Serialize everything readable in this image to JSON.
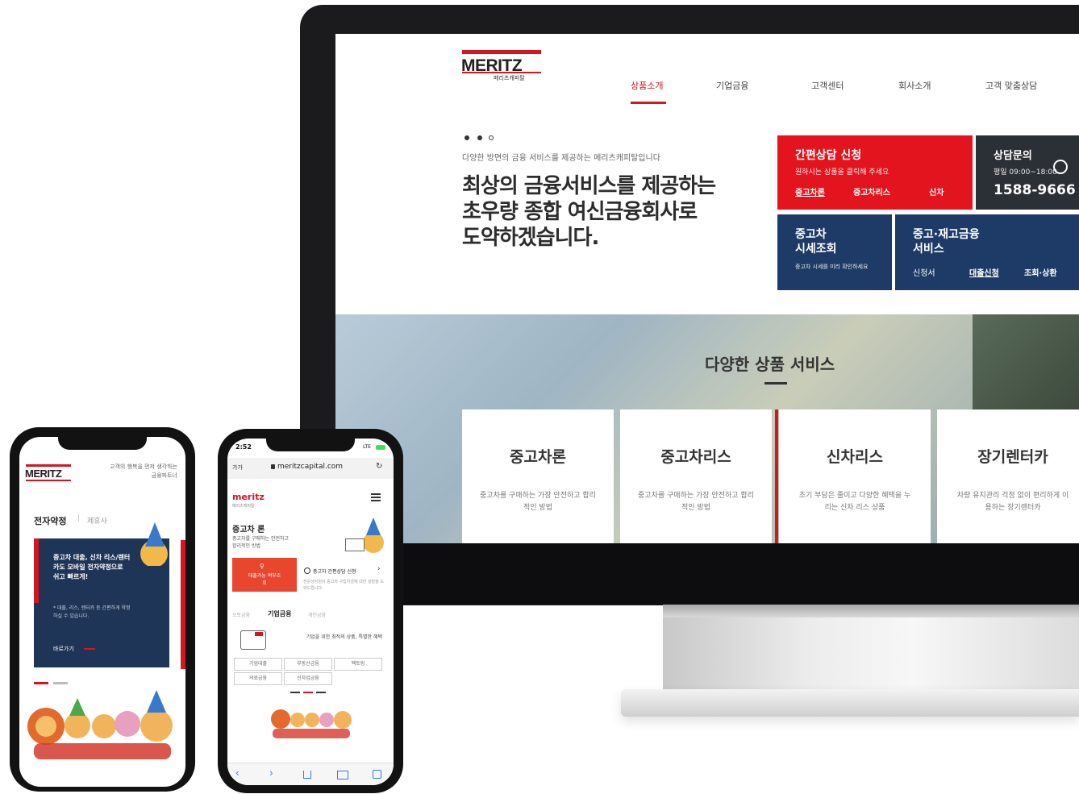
{
  "desktop": {
    "logo": {
      "text": "MERITZ",
      "sub": "메리츠캐피탈"
    },
    "nav": [
      "상품소개",
      "기업금융",
      "고객센터",
      "회사소개",
      "고객 맞춤상담"
    ],
    "hero": {
      "small": "다양한 방면의 금융 서비스를 제공하는 메리츠캐피탈입니다",
      "lines": [
        "최상의 금융서비스를 제공하는",
        "초우량 종합 여신금융회사로",
        "도약하겠습니다."
      ]
    },
    "tiles": {
      "consult": {
        "title": "간편상담 신청",
        "sub": "원하시는 상품을 클릭해 주세요",
        "links": [
          "중고차론",
          "중고차리스",
          "신차"
        ]
      },
      "phone": {
        "title": "상담문의",
        "sub": "평일 09:00~18:00",
        "number": "1588-9666"
      },
      "market": {
        "title": "중고차",
        "title2": "시세조회",
        "sub": "중고차 시세를 미리 확인하세요"
      },
      "stock": {
        "title": "중고·재고금융",
        "title2": "서비스",
        "links": [
          "신청서",
          "대출신청",
          "조회·상환"
        ]
      }
    },
    "banner_title": "다양한 상품 서비스",
    "cards": [
      {
        "title": "중고차론",
        "desc": "중고차를 구매하는 가장 안전하고 합리적인 방법"
      },
      {
        "title": "중고차리스",
        "desc": "중고차를 구매하는 가장 안전하고 합리적인 방법"
      },
      {
        "title": "신차리스",
        "desc": "초기 부담은 줄이고 다양한 혜택을 누리는 신차 리스 상품"
      },
      {
        "title": "장기렌터카",
        "desc": "차량 유지관리 걱정 없이 편리하게 이용하는 장기렌터카"
      }
    ]
  },
  "phone1": {
    "logo": "MERITZ",
    "tagline": "고객의 행복을 먼저 생각하는 금융파트너",
    "tab_active": "전자약정",
    "tab_sep": "|",
    "tab_other": "제휴사",
    "card_title": "중고차 대출, 신차 리스/렌터카도 모바일 전자약정으로 쉬고 빠르게!",
    "card_desc": "* 대출, 리스, 렌터카 등 간편하게 약정하실 수 있습니다.",
    "card_link": "바로가기"
  },
  "phone2": {
    "time": "2:52",
    "signal": "LTE",
    "url_prefix": "가가",
    "url": "meritzcapital.com",
    "logo": "meritz",
    "logo_sub": "메리츠캐피탈",
    "product_title": "중고차 론",
    "product_desc": "중고차를 구매하는 안전하고 합리적인 방법",
    "loan_button": "대출가능 여부조회",
    "consult_link": "중고차 간편상담 신청",
    "consult_desc": "전문상담원이 중고차 구입자금에 대한 상담을 도와드립니다.",
    "tabs": [
      "오토금융",
      "기업금융",
      "개인금융"
    ],
    "corp_text": "기업을 위한 최적의 상품, 특별한 혜택",
    "chips": [
      "기업대출",
      "부동산금융",
      "팩토링",
      "의료금융",
      "신자업금융"
    ]
  }
}
